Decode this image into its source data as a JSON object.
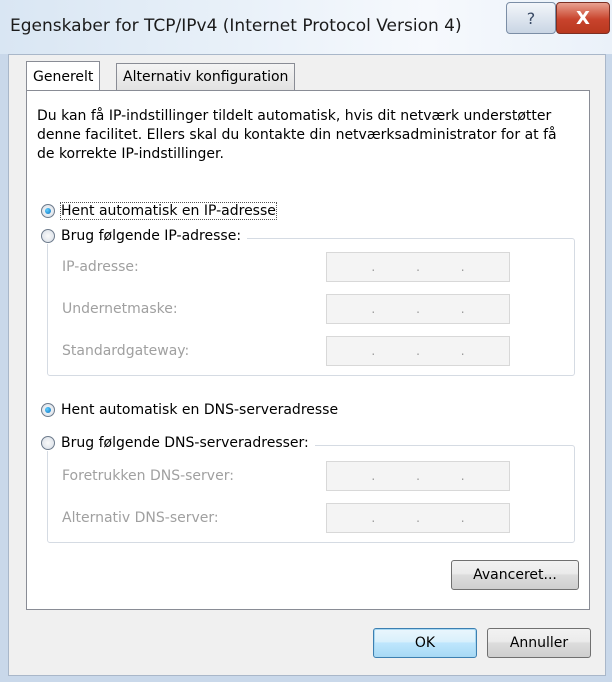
{
  "window": {
    "title": "Egenskaber for TCP/IPv4 (Internet Protocol Version 4)",
    "help_label": "?",
    "close_label": "X"
  },
  "tabs": [
    {
      "label": "Generelt",
      "active": true
    },
    {
      "label": "Alternativ konfiguration",
      "active": false
    }
  ],
  "description": "Du kan få IP-indstillinger tildelt automatisk, hvis dit netværk understøtter denne facilitet. Ellers skal du kontakte din netværksadministrator for at få de korrekte IP-indstillinger.",
  "ip": {
    "auto_label": "Hent automatisk en IP-adresse",
    "manual_label": "Brug følgende IP-adresse:",
    "selected": "auto",
    "fields": [
      {
        "label": "IP-adresse:",
        "value": ""
      },
      {
        "label": "Undernetmaske:",
        "value": ""
      },
      {
        "label": "Standardgateway:",
        "value": ""
      }
    ]
  },
  "dns": {
    "auto_label": "Hent automatisk en DNS-serveradresse",
    "manual_label": "Brug følgende DNS-serveradresser:",
    "selected": "auto",
    "fields": [
      {
        "label": "Foretrukken DNS-server:",
        "value": ""
      },
      {
        "label": "Alternativ DNS-server:",
        "value": ""
      }
    ]
  },
  "buttons": {
    "advanced": "Avanceret...",
    "ok": "OK",
    "cancel": "Annuller"
  },
  "ip_separator": "."
}
